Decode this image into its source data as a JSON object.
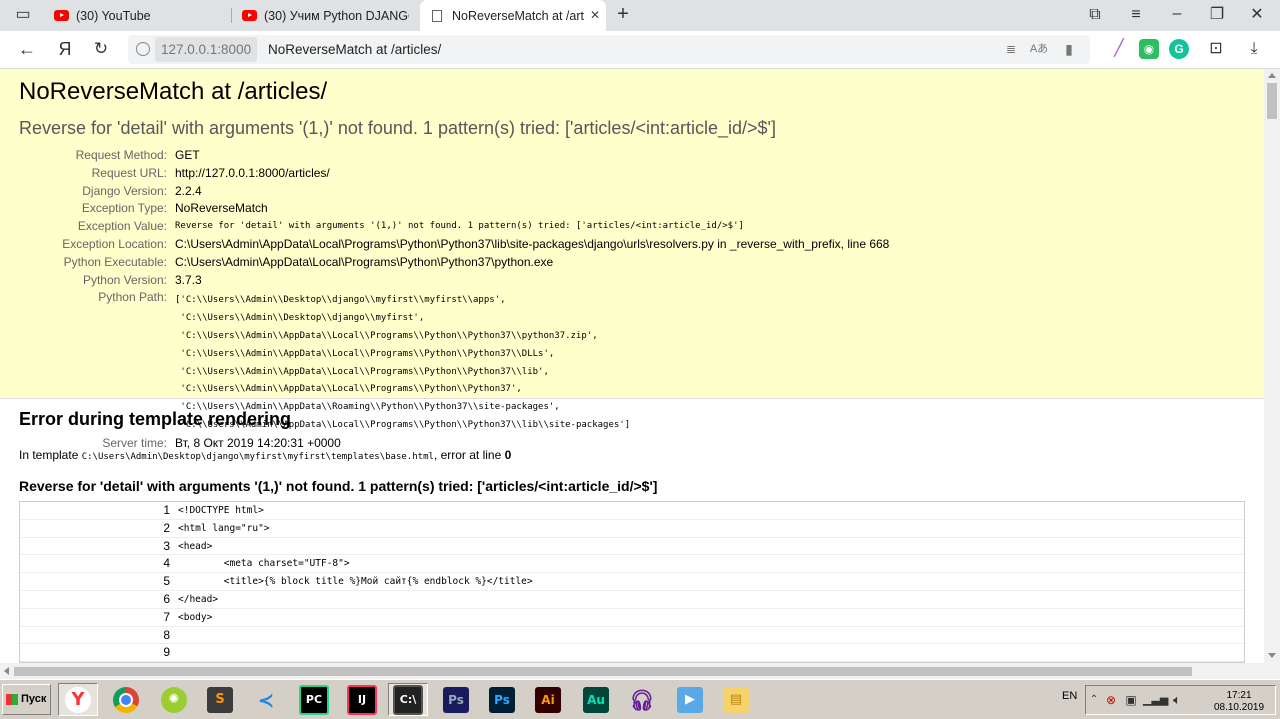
{
  "browser": {
    "tabs": [
      {
        "title": "(30) YouTube",
        "icon": "youtube-icon"
      },
      {
        "title": "(30) Учим Python DJANGO",
        "icon": "youtube-icon"
      },
      {
        "title": "NoReverseMatch at /articles/",
        "icon": "page-icon",
        "active": true
      }
    ],
    "address": {
      "host": "127.0.0.1:8000",
      "title": "NoReverseMatch at /articles/"
    }
  },
  "page": {
    "title": "NoReverseMatch at /articles/",
    "subtitle": "Reverse for 'detail' with arguments '(1,)' not found. 1 pattern(s) tried: ['articles/<int:article_id/>$']",
    "meta": [
      {
        "label": "Request Method:",
        "value": "GET"
      },
      {
        "label": "Request URL:",
        "value": "http://127.0.0.1:8000/articles/"
      },
      {
        "label": "Django Version:",
        "value": "2.2.4"
      },
      {
        "label": "Exception Type:",
        "value": "NoReverseMatch"
      },
      {
        "label": "Exception Value:",
        "value": "Reverse for 'detail' with arguments '(1,)' not found. 1 pattern(s) tried: ['articles/<int:article_id/>$']"
      },
      {
        "label": "Exception Location:",
        "value": "C:\\Users\\Admin\\AppData\\Local\\Programs\\Python\\Python37\\lib\\site-packages\\django\\urls\\resolvers.py in _reverse_with_prefix, line 668"
      },
      {
        "label": "Python Executable:",
        "value": "C:\\Users\\Admin\\AppData\\Local\\Programs\\Python\\Python37\\python.exe"
      },
      {
        "label": "Python Version:",
        "value": "3.7.3"
      },
      {
        "label": "Python Path:",
        "value": "['C:\\\\Users\\\\Admin\\\\Desktop\\\\django\\\\myfirst\\\\myfirst\\\\apps',\n 'C:\\\\Users\\\\Admin\\\\Desktop\\\\django\\\\myfirst',\n 'C:\\\\Users\\\\Admin\\\\AppData\\\\Local\\\\Programs\\\\Python\\\\Python37\\\\python37.zip',\n 'C:\\\\Users\\\\Admin\\\\AppData\\\\Local\\\\Programs\\\\Python\\\\Python37\\\\DLLs',\n 'C:\\\\Users\\\\Admin\\\\AppData\\\\Local\\\\Programs\\\\Python\\\\Python37\\\\lib',\n 'C:\\\\Users\\\\Admin\\\\AppData\\\\Local\\\\Programs\\\\Python\\\\Python37',\n 'C:\\\\Users\\\\Admin\\\\AppData\\\\Roaming\\\\Python\\\\Python37\\\\site-packages',\n 'C:\\\\Users\\\\Admin\\\\AppData\\\\Local\\\\Programs\\\\Python\\\\Python37\\\\lib\\\\site-packages']"
      },
      {
        "label": "Server time:",
        "value": "Вт, 8 Окт 2019 14:20:31 +0000"
      }
    ],
    "template_error": {
      "heading": "Error during template rendering",
      "in_template_prefix": "In template ",
      "template_path": "C:\\Users\\Admin\\Desktop\\django\\myfirst\\myfirst\\templates\\base.html",
      "error_at_line": ", error at line ",
      "line": "0",
      "message": "Reverse for 'detail' with arguments '(1,)' not found. 1 pattern(s) tried: ['articles/<int:article_id/>$']",
      "source": [
        {
          "num": "1",
          "code": "<!DOCTYPE html>"
        },
        {
          "num": "2",
          "code": "<html lang=\"ru\">"
        },
        {
          "num": "3",
          "code": "<head>"
        },
        {
          "num": "4",
          "code": "        <meta charset=\"UTF-8\">"
        },
        {
          "num": "5",
          "code": "        <title>{% block title %}Мой сайт{% endblock %}</title>"
        },
        {
          "num": "6",
          "code": "</head>"
        },
        {
          "num": "7",
          "code": "<body>"
        },
        {
          "num": "8",
          "code": ""
        },
        {
          "num": "9",
          "code": ""
        }
      ]
    }
  },
  "taskbar": {
    "start_label": "Пуск",
    "apps": [
      "yandex-browser-icon",
      "chrome-icon",
      "lime-icon",
      "sublime-text-icon",
      "vscode-icon",
      "pycharm-icon",
      "intellij-icon",
      "terminal-icon",
      "photoshop-icon",
      "photoshop-blue-icon",
      "illustrator-icon",
      "audition-icon",
      "headphones-icon",
      "media-player-icon",
      "folder-icon"
    ],
    "language": "EN",
    "time": "17:21",
    "date": "08.10.2019"
  }
}
